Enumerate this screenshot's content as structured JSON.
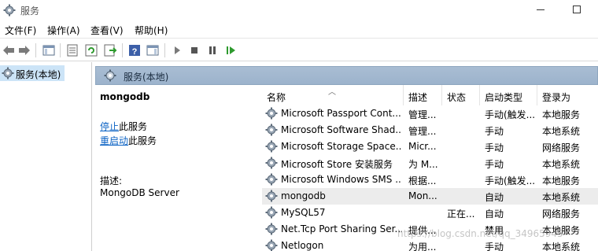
{
  "window": {
    "title": "服务"
  },
  "menu": [
    "文件(F)",
    "操作(A)",
    "查看(V)",
    "帮助(H)"
  ],
  "toolbar": {
    "icons": [
      "back-icon",
      "forward-icon",
      "show-hide-tree-icon",
      "properties-icon",
      "refresh-icon",
      "export-list-icon",
      "help-icon",
      "show-hide-action-pane-icon",
      "start-service-icon",
      "stop-service-icon",
      "pause-service-icon",
      "resume-service-icon"
    ]
  },
  "tree": {
    "item": "服务(本地)"
  },
  "pane": {
    "header": "服务(本地)"
  },
  "details": {
    "name": "mongodb",
    "stop_link": "停止",
    "stop_suffix": "此服务",
    "restart_link": "重启动",
    "restart_suffix": "此服务",
    "desc_label": "描述:",
    "desc_value": "MongoDB Server"
  },
  "list": {
    "columns": [
      "名称",
      "描述",
      "状态",
      "启动类型",
      "登录为"
    ],
    "rows": [
      {
        "name": "Microsoft Passport Cont...",
        "desc": "管理...",
        "status": "",
        "startup": "手动(触发...",
        "logon": "本地服务"
      },
      {
        "name": "Microsoft Software Shad...",
        "desc": "管理...",
        "status": "",
        "startup": "手动",
        "logon": "本地系统"
      },
      {
        "name": "Microsoft Storage Space...",
        "desc": "Micr...",
        "status": "",
        "startup": "手动",
        "logon": "网络服务"
      },
      {
        "name": "Microsoft Store 安装服务",
        "desc": "为 M...",
        "status": "",
        "startup": "手动",
        "logon": "本地系统"
      },
      {
        "name": "Microsoft Windows SMS ...",
        "desc": "根据...",
        "status": "",
        "startup": "手动(触发...",
        "logon": "本地服务"
      },
      {
        "name": "mongodb",
        "desc": "Mon...",
        "status": "",
        "startup": "自动",
        "logon": "本地系统"
      },
      {
        "name": "MySQL57",
        "desc": "",
        "status": "正在...",
        "startup": "自动",
        "logon": "网络服务"
      },
      {
        "name": "Net.Tcp Port Sharing Ser...",
        "desc": "提供...",
        "status": "",
        "startup": "禁用",
        "logon": "本地服务"
      },
      {
        "name": "Netlogon",
        "desc": "为用...",
        "status": "",
        "startup": "手动",
        "logon": "本地系统"
      }
    ]
  },
  "watermark": "https://blog.csdn.net/qq_34965945",
  "colors": {
    "pane_header": "#a9bdd3",
    "selection": "#cce4f7",
    "link": "#0c63c4"
  }
}
